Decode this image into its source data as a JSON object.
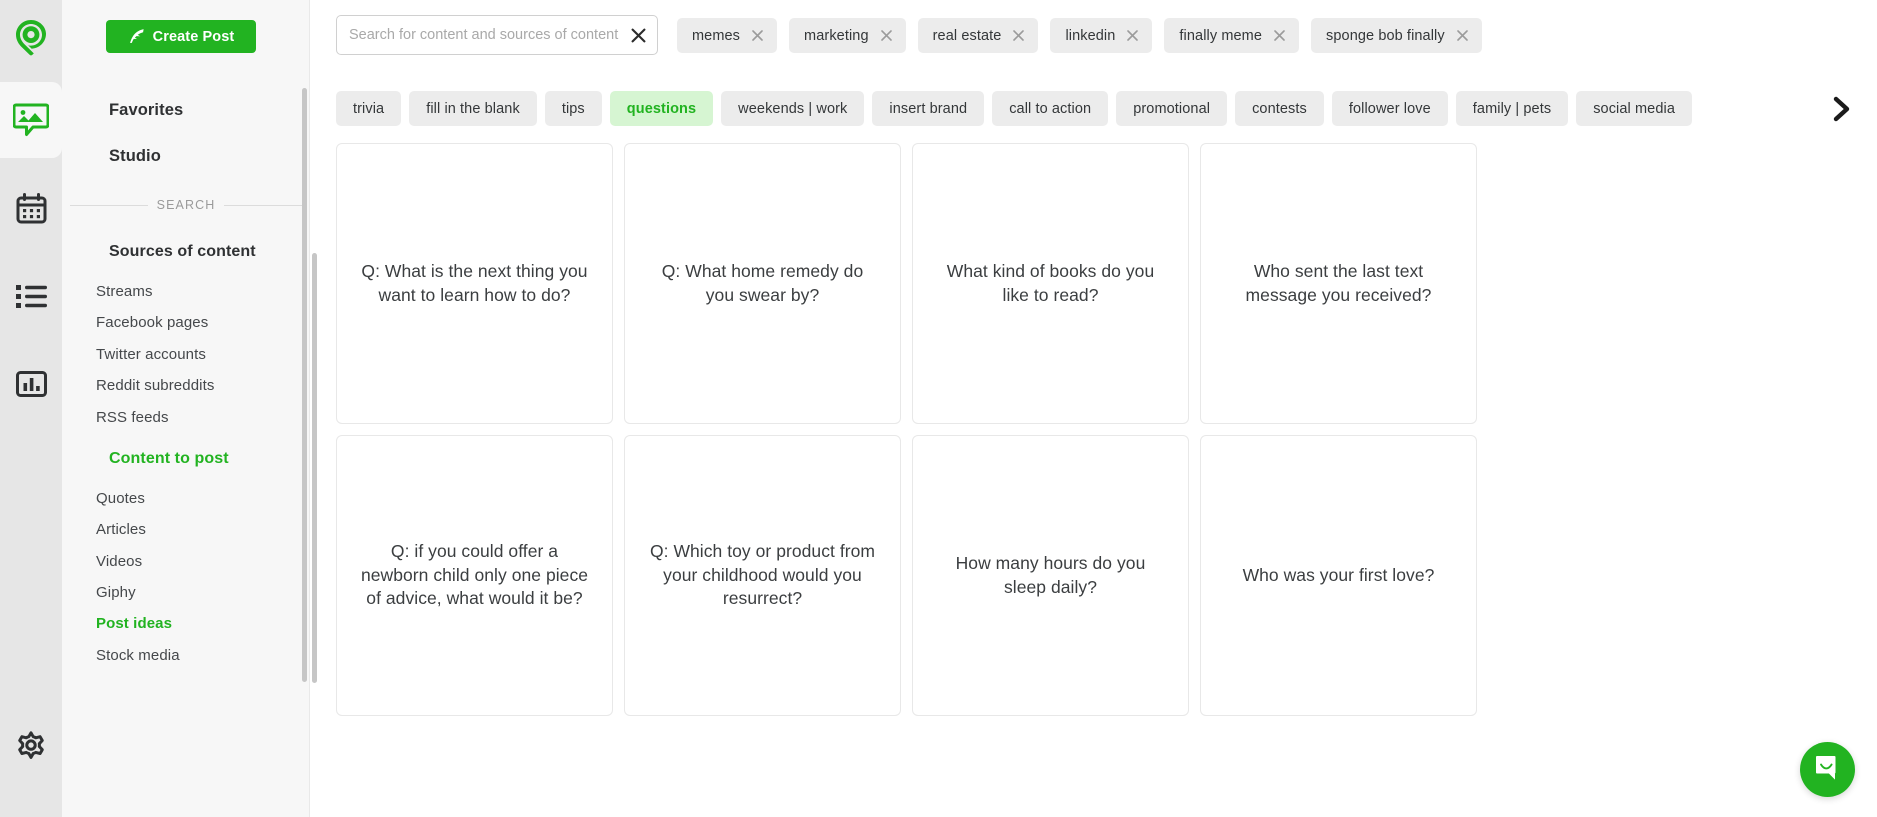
{
  "rail": {
    "items": [
      {
        "name": "logo-pin-icon",
        "label": "Post Planner logo"
      },
      {
        "name": "media-icon",
        "label": "Media"
      },
      {
        "name": "calendar-icon",
        "label": "Calendar"
      },
      {
        "name": "list-icon",
        "label": "Queue"
      },
      {
        "name": "analytics-icon",
        "label": "Analytics"
      },
      {
        "name": "gear-icon",
        "label": "Settings"
      }
    ]
  },
  "sidebar": {
    "create_post_label": "Create Post",
    "top_items": [
      {
        "label": "Favorites"
      },
      {
        "label": "Studio"
      }
    ],
    "divider_label": "SEARCH",
    "groups": [
      {
        "title": "Sources of content",
        "active": false,
        "items": [
          {
            "label": "Streams",
            "active": false
          },
          {
            "label": "Facebook pages",
            "active": false
          },
          {
            "label": "Twitter accounts",
            "active": false
          },
          {
            "label": "Reddit subreddits",
            "active": false
          },
          {
            "label": "RSS feeds",
            "active": false
          }
        ]
      },
      {
        "title": "Content to post",
        "active": true,
        "items": [
          {
            "label": "Quotes",
            "active": false
          },
          {
            "label": "Articles",
            "active": false
          },
          {
            "label": "Videos",
            "active": false
          },
          {
            "label": "Giphy",
            "active": false
          },
          {
            "label": "Post ideas",
            "active": true
          },
          {
            "label": "Stock media",
            "active": false
          }
        ]
      }
    ]
  },
  "search": {
    "value": "",
    "placeholder": "Search for content and sources of content...",
    "clear_icon": "close-icon"
  },
  "tags": [
    {
      "label": "memes"
    },
    {
      "label": "marketing"
    },
    {
      "label": "real estate"
    },
    {
      "label": "linkedin"
    },
    {
      "label": "finally meme"
    },
    {
      "label": "sponge bob finally"
    }
  ],
  "categories": [
    {
      "label": "trivia",
      "active": false
    },
    {
      "label": "fill in the blank",
      "active": false
    },
    {
      "label": "tips",
      "active": false
    },
    {
      "label": "questions",
      "active": true
    },
    {
      "label": "weekends | work",
      "active": false
    },
    {
      "label": "insert brand",
      "active": false
    },
    {
      "label": "call to action",
      "active": false
    },
    {
      "label": "promotional",
      "active": false
    },
    {
      "label": "contests",
      "active": false
    },
    {
      "label": "follower love",
      "active": false
    },
    {
      "label": "family | pets",
      "active": false
    },
    {
      "label": "social media",
      "active": false
    }
  ],
  "category_scroll_next_icon": "chevron-right-icon",
  "cards": [
    {
      "text": "Q: What is the next thing you want to learn how to do?"
    },
    {
      "text": "Q: What home remedy do you swear by?"
    },
    {
      "text": "What kind of books do you like to read?"
    },
    {
      "text": "Who sent the last text message you received?"
    },
    {
      "text": "Q: if you could offer a newborn child only one piece of advice, what would it be?"
    },
    {
      "text": "Q: Which toy or product from your childhood would you resurrect?"
    },
    {
      "text": "How many hours do you sleep daily?"
    },
    {
      "text": "Who was your first love?"
    }
  ],
  "intercom": {
    "icon": "chat-bubble-icon"
  },
  "colors": {
    "brand_green": "#22b321",
    "active_pill_bg": "#d6f5d2",
    "chip_bg": "#ececec",
    "panel_bg": "#f7f7f7",
    "rail_bg": "#e6e6e6"
  }
}
